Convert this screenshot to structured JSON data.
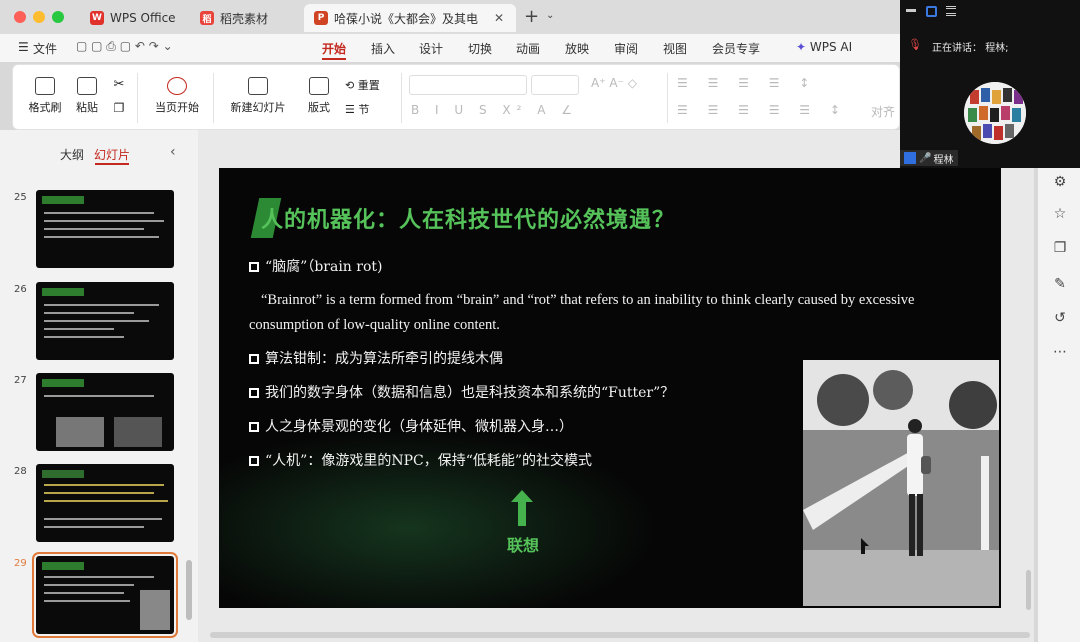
{
  "tabs": [
    {
      "label": "WPS Office",
      "icon": "W"
    },
    {
      "label": "稻壳素材",
      "icon": "稻"
    },
    {
      "label": "哈葆小说《大都会》及其电",
      "icon": "P"
    }
  ],
  "menu": {
    "file": "文件",
    "items": [
      "开始",
      "插入",
      "设计",
      "切换",
      "动画",
      "放映",
      "审阅",
      "视图",
      "会员专享"
    ],
    "active": "开始",
    "ai": "WPS AI"
  },
  "ribbon": {
    "format_painter": "格式刷",
    "paste": "粘贴",
    "play_current": "当页开始",
    "new_slide": "新建幻灯片",
    "layout": "版式",
    "reset": "重置",
    "section": "节",
    "align": "对齐"
  },
  "leftpanel": {
    "tab_outline": "大纲",
    "tab_slides": "幻灯片",
    "slide_numbers": [
      "25",
      "26",
      "27",
      "28",
      "29"
    ]
  },
  "slide": {
    "title": "人的机器化：人在科技世代的必然境遇？",
    "b1": "“脑腐”（brain rot)",
    "para": "“Brainrot” is a term formed from “brain” and “rot” that refers to an inability to think clearly caused by excessive consumption of low-quality online content.",
    "b2": "算法钳制：成为算法所牵引的提线木偶",
    "b3": "我们的数字身体（数据和信息）也是科技资本和系统的“Futter”？",
    "b4": "人之身体景观的变化（身体延伸、微机器入身…）",
    "b5": "“人机”：像游戏里的NPC，保持“低耗能”的社交模式",
    "arrow_label": "联想"
  },
  "meeting": {
    "speaking": "正在讲话：",
    "speaker": "程林;",
    "participant": "程林"
  },
  "colors": {
    "accent": "#c3291f",
    "slide_green": "#56c25a"
  }
}
